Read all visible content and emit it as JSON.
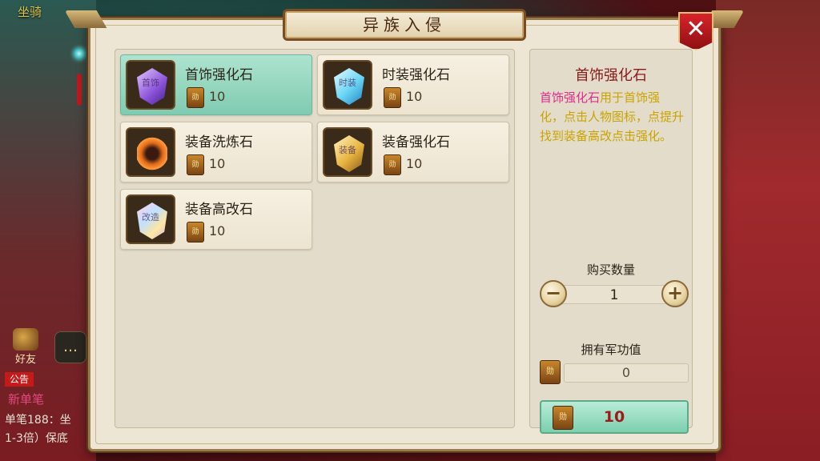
{
  "background": {
    "top_left_label": "坐骑",
    "friend_label": "好友",
    "notice_tag": "公告",
    "chat_line1": "新单笔",
    "chat_line2": "单笔188：坐",
    "chat_line3": "1-3倍）保底"
  },
  "dialog": {
    "title": "异族入侵",
    "close_symbol": "✕"
  },
  "currency": {
    "icon_name": "military-merit-token-icon",
    "glyph": "勋"
  },
  "items": [
    {
      "name": "首饰强化石",
      "price": "10",
      "gem": "purple",
      "glyph": "首饰",
      "selected": true
    },
    {
      "name": "时装强化石",
      "price": "10",
      "gem": "blue",
      "glyph": "时装",
      "selected": false
    },
    {
      "name": "装备洗炼石",
      "price": "10",
      "gem": "fire",
      "glyph": "",
      "selected": false
    },
    {
      "name": "装备强化石",
      "price": "10",
      "gem": "gold",
      "glyph": "装备",
      "selected": false
    },
    {
      "name": "装备高改石",
      "price": "10",
      "gem": "rainbow",
      "glyph": "改造",
      "selected": false
    }
  ],
  "detail": {
    "title": "首饰强化石",
    "desc_highlight": "首饰强化石",
    "desc_rest": "用于首饰强化，点击人物图标，点提升找到装备高改点击强化。",
    "qty_label": "购买数量",
    "qty_value": "1",
    "minus_symbol": "−",
    "plus_symbol": "+",
    "merit_label": "拥有军功值",
    "merit_value": "0",
    "buy_price": "10"
  },
  "colors": {
    "selected_card": "#7fcbb1",
    "price_red": "#a01a1a",
    "desc_yellow": "#c9a400",
    "desc_pink": "#e02a8a"
  }
}
